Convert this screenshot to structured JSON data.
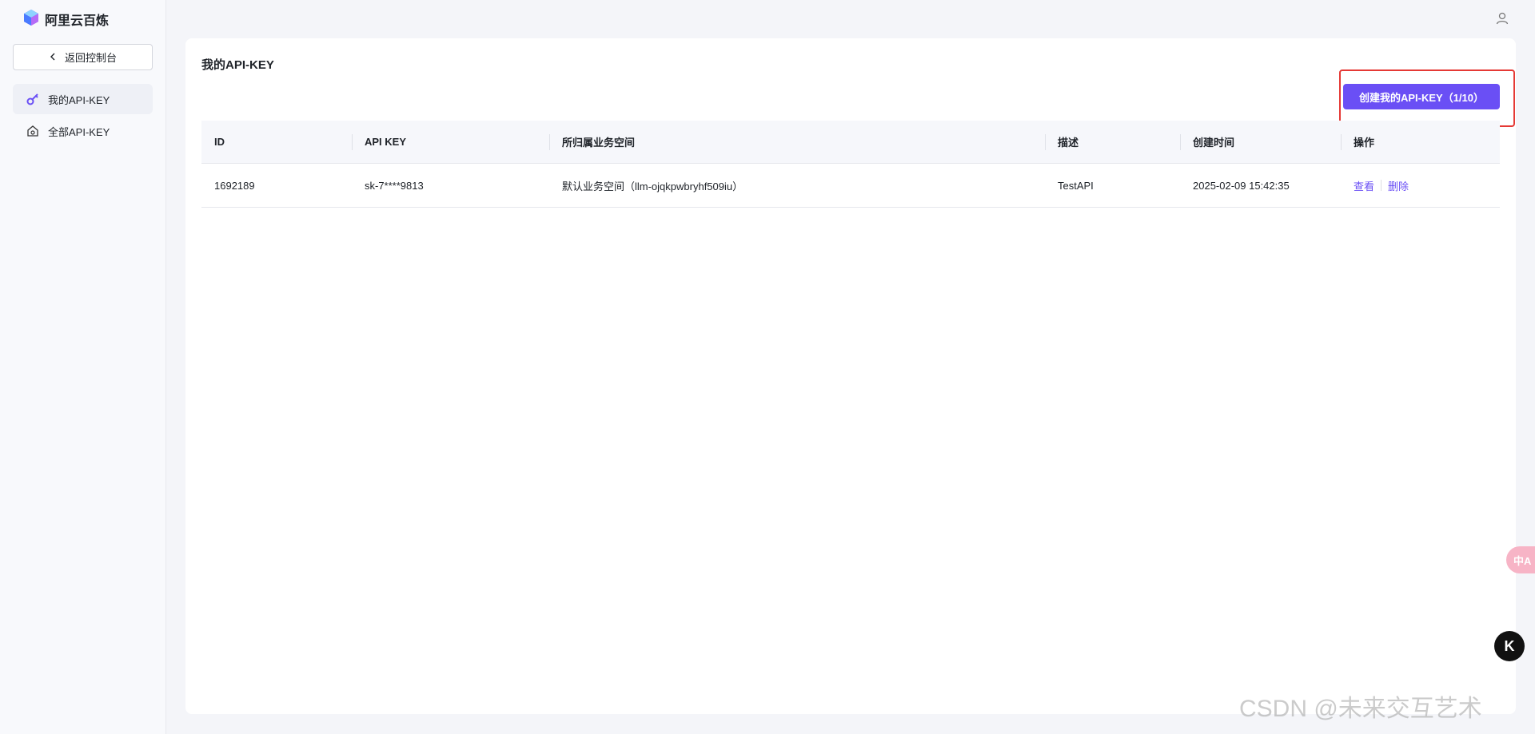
{
  "app": {
    "brand": "阿里云百炼",
    "user_icon": "user-icon"
  },
  "sidebar": {
    "back_label": "返回控制台",
    "items": [
      {
        "label": "我的API-KEY",
        "icon": "key-icon",
        "active": true
      },
      {
        "label": "全部API-KEY",
        "icon": "house-icon",
        "active": false
      }
    ]
  },
  "main": {
    "title": "我的API-KEY",
    "create_button": "创建我的API-KEY（1/10）",
    "table": {
      "headers": [
        "ID",
        "API KEY",
        "所归属业务空间",
        "描述",
        "创建时间",
        "操作"
      ],
      "rows": [
        {
          "id": "1692189",
          "api_key": "sk-7****9813",
          "workspace": "默认业务空间（llm-ojqkpwbryhf509iu）",
          "description": "TestAPI",
          "created": "2025-02-09 15:42:35",
          "actions": [
            "查看",
            "删除"
          ]
        }
      ]
    }
  },
  "floating": {
    "translate": "中A",
    "assistant": "K"
  },
  "watermark": "CSDN @未来交互艺术",
  "colors": {
    "accent": "#6a4ff5",
    "highlight": "#e53935"
  }
}
